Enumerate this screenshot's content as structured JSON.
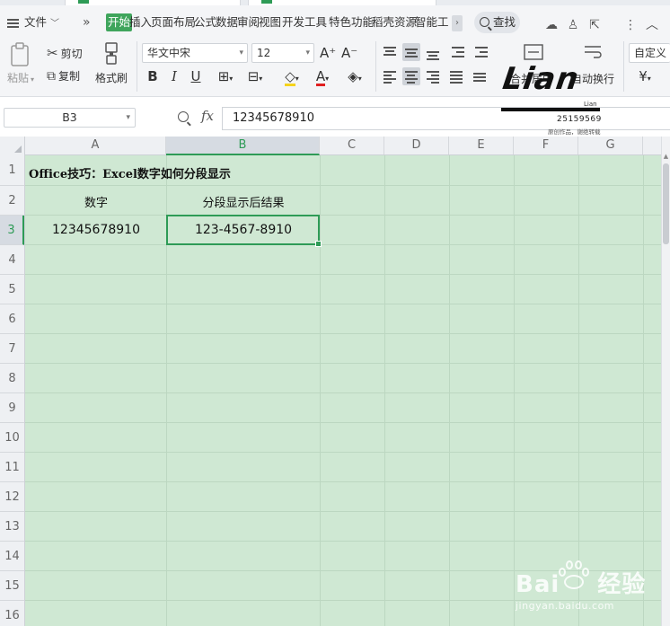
{
  "menubar": {
    "file": "文件",
    "more": "»",
    "tabs": [
      "开始",
      "插入",
      "页面布局",
      "公式",
      "数据",
      "审阅",
      "视图",
      "开发工具",
      "特色功能",
      "稻壳资源",
      "智能工具"
    ],
    "visible_last_tab": "智能工",
    "scroll": "›",
    "search": "查找"
  },
  "ribbon": {
    "paste": "粘贴",
    "cut": "剪切",
    "copy": "复制",
    "format_painter": "格式刷",
    "font_name": "华文中宋",
    "font_size": "12",
    "bold": "B",
    "italic": "I",
    "underline": "U",
    "font_color_glyph": "A",
    "merge_center": "合并居中",
    "wrap_text": "自动换行",
    "number_format": "自定义",
    "currency": "¥"
  },
  "formula_bar": {
    "name_box": "B3",
    "fx": "fx",
    "formula": "12345678910"
  },
  "watermark_logo": {
    "signature": "Lian",
    "small_text": "Lian",
    "id": "25159569",
    "caption": "原创作品，谢绝转载"
  },
  "sheet": {
    "columns": [
      "A",
      "B",
      "C",
      "D",
      "E",
      "F",
      "G"
    ],
    "rows": [
      "1",
      "2",
      "3",
      "4",
      "5",
      "6",
      "7",
      "8",
      "9",
      "10",
      "11",
      "12",
      "13",
      "14",
      "15",
      "16"
    ],
    "selected_col": "B",
    "selected_row": "3",
    "cells": {
      "A1": "Office技巧：Excel数字如何分段显示",
      "A2": "数字",
      "B2": "分段显示后结果",
      "A3": "12345678910",
      "B3": "123-4567-8910"
    }
  },
  "baidu_watermark": {
    "brand": "Bai",
    "brand2": "经验",
    "site": "jingyan.baidu.com"
  },
  "colors": {
    "accent": "#2e9b56",
    "sheet_bg": "#cfe8d3",
    "active_tab_bg": "#3fa55c"
  }
}
